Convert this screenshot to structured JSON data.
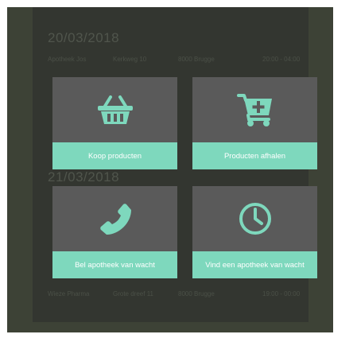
{
  "background": {
    "sections": [
      {
        "date": "20/03/2018",
        "rows": [
          [
            "Apotheek Jos",
            "Kerkweg 10",
            "8000 Brugge",
            "20:00 - 04:00"
          ]
        ]
      },
      {
        "date": "21/03/2018",
        "rows": [
          [
            "Wieze Pharma",
            "Grote dreef 11",
            "8000 Brugge",
            "19:00 - 00:00"
          ]
        ]
      }
    ]
  },
  "tiles": [
    {
      "label": "Koop producten",
      "icon": "basket-icon"
    },
    {
      "label": "Producten afhalen",
      "icon": "cart-plus-icon"
    },
    {
      "label": "Bel apotheek van wacht",
      "icon": "phone-icon"
    },
    {
      "label": "Vind een apotheek van wacht",
      "icon": "clock-icon"
    }
  ],
  "colors": {
    "accent": "#7ed8bd",
    "tile": "#5a5a5a",
    "overlay": "#333630",
    "frame": "#3d4236"
  }
}
